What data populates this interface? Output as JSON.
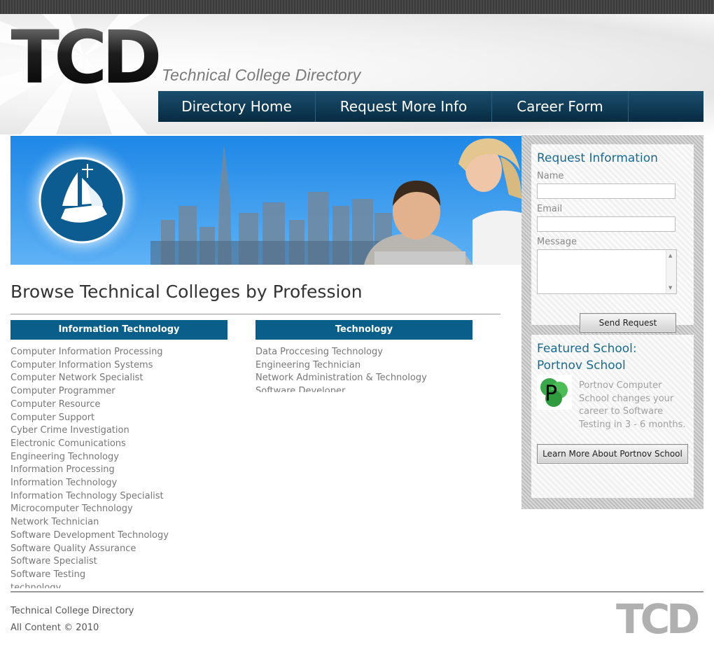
{
  "header": {
    "logo_text": "TCD",
    "tagline": "Technical College Directory"
  },
  "nav": {
    "items": [
      "Directory Home",
      "Request More Info",
      "Career Form"
    ]
  },
  "main": {
    "heading": "Browse Technical Colleges by Profession",
    "categories": [
      {
        "title": "Information Technology",
        "items": [
          "Computer Information Processing",
          "Computer Information Systems",
          "Computer Network Specialist",
          "Computer Programmer",
          "Computer Resource",
          "Computer Support",
          "Cyber Crime Investigation",
          "Electronic Comunications",
          "Engineering Technology",
          "Information Processing",
          "Information Technology",
          "Information Technology Specialist",
          "Microcomputer Technology",
          "Network Technician",
          "Software Development Technology",
          "Software Quality Assurance",
          "Software Specialist",
          "Software Testing",
          "technology"
        ]
      },
      {
        "title": "Technology",
        "items": [
          "Data Proccesing Technology",
          "Engineering Technician",
          "Network Administration & Technology",
          "Software Developer"
        ]
      }
    ]
  },
  "sidebar": {
    "request": {
      "title": "Request Information",
      "name_label": "Name",
      "email_label": "Email",
      "message_label": "Message",
      "name_value": "",
      "email_value": "",
      "message_value": "",
      "submit_label": "Send Request"
    },
    "featured": {
      "title_line1": "Featured School:",
      "title_line2": "Portnov School",
      "logo_letter": "P",
      "description": "Portnov Computer School changes your career to Software Testing in 3 - 6 months.",
      "button_label": "Learn More About Portnov School"
    }
  },
  "footer": {
    "line1": "Technical College Directory",
    "line2": "All Content © 2010",
    "logo_text": "TCD"
  },
  "colors": {
    "nav_bg": "#082b41",
    "category_bg": "#0a5f8a",
    "panel_title": "#1a6a8e",
    "link_text": "#777777"
  }
}
